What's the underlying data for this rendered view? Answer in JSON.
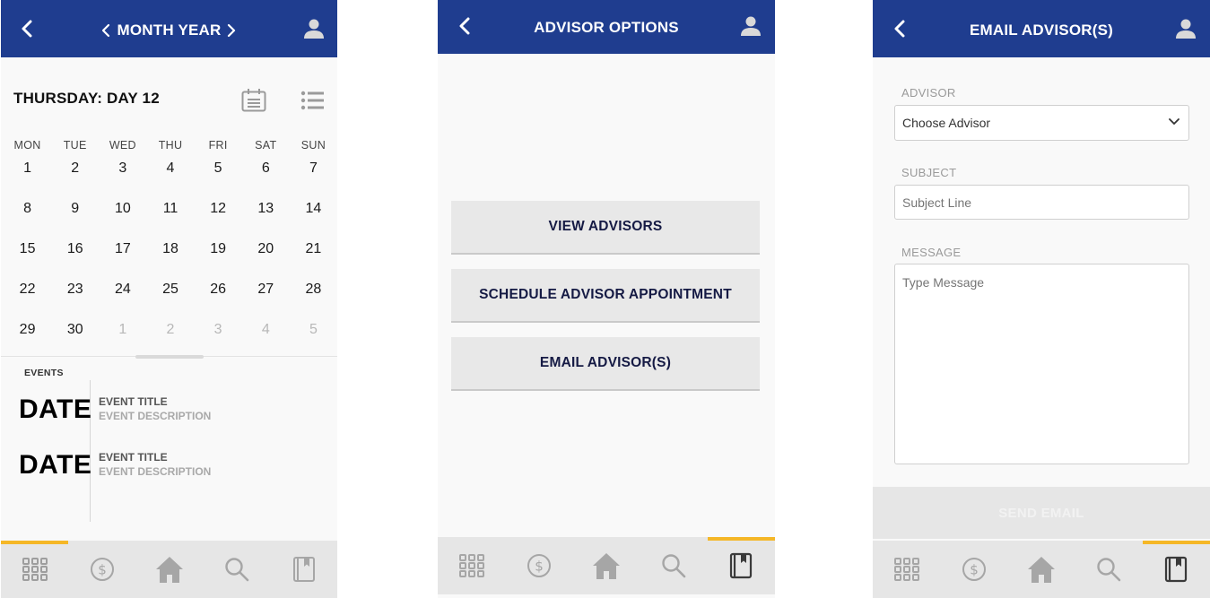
{
  "calendar_screen": {
    "header": {
      "title": "MONTH YEAR"
    },
    "day_heading": "THURSDAY: DAY 12",
    "weekdays": [
      "MON",
      "TUE",
      "WED",
      "THU",
      "FRI",
      "SAT",
      "SUN"
    ],
    "weeks": [
      [
        "1",
        "2",
        "3",
        "4",
        "5",
        "6",
        "7"
      ],
      [
        "8",
        "9",
        "10",
        "11",
        "12",
        "13",
        "14"
      ],
      [
        "15",
        "16",
        "17",
        "18",
        "19",
        "20",
        "21"
      ],
      [
        "22",
        "23",
        "24",
        "25",
        "26",
        "27",
        "28"
      ],
      [
        "29",
        "30",
        "1",
        "2",
        "3",
        "4",
        "5"
      ]
    ],
    "events_label": "EVENTS",
    "events": [
      {
        "date": "DATE",
        "title": "EVENT TITLE",
        "description": "EVENT DESCRIPTION"
      },
      {
        "date": "DATE",
        "title": "EVENT TITLE",
        "description": "EVENT DESCRIPTION"
      }
    ],
    "active_tab": "grid"
  },
  "advisor_options_screen": {
    "header": {
      "title": "ADVISOR OPTIONS"
    },
    "buttons": [
      "VIEW ADVISORS",
      "SCHEDULE ADVISOR APPOINTMENT",
      "EMAIL ADVISOR(S)"
    ],
    "active_tab": "book"
  },
  "email_advisor_screen": {
    "header": {
      "title": "EMAIL ADVISOR(S)"
    },
    "advisor": {
      "label": "ADVISOR",
      "value": "Choose Advisor"
    },
    "subject": {
      "label": "SUBJECT",
      "placeholder": "Subject Line"
    },
    "message": {
      "label": "MESSAGE",
      "placeholder": "Type Message"
    },
    "send_label": "SEND EMAIL",
    "active_tab": "book"
  },
  "tabs": [
    "grid-icon",
    "dollar-icon",
    "home-icon",
    "search-icon",
    "book-icon"
  ],
  "colors": {
    "header": "#1f3d8f",
    "accent": "#f5b727",
    "tabbar": "#e6e6e6",
    "icon_gray": "#a6a6a6"
  }
}
